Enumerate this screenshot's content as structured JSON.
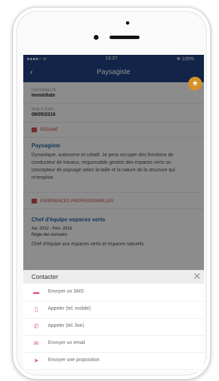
{
  "status_bar": {
    "carrier": "●●●●○ ᯤ",
    "time": "13:37",
    "battery": "✻ 100%"
  },
  "nav": {
    "back": "‹",
    "title": "Paysagiste"
  },
  "profile": {
    "availability_label": "DISPONIBILITÉ",
    "availability_value": "Immédiate",
    "updated_label": "MISE À JOUR",
    "updated_value": "08/05/2016",
    "summary_header": "RÉSUMÉ",
    "summary_title": "Paysagiste",
    "summary_text": "Dynamique, autonome et créatif. Je peux occuper des fonctions de conducteur de travaux, responsable gestion des espaces verts ou concepteur de paysage selon la taille et la nature de la structure qui m'emploie.",
    "experience_header": "EXPÉRIENCES PROFESSIONNELLES",
    "job_title": "Chef d'équipe espaces verts",
    "job_dates": "Avr. 2012 - Févr. 2016",
    "job_company": "Régie des écrivains",
    "job_text": "Chef d'équipe aux espaces verts et espaces naturels."
  },
  "contact_sheet": {
    "title": "Contacter",
    "close": "✕",
    "items": [
      {
        "label": "Envoyer un SMS",
        "icon": "sms-icon"
      },
      {
        "label": "Appeler (tel. mobile)",
        "icon": "mobile-icon"
      },
      {
        "label": "Appeler (tel. fixe)",
        "icon": "phone-icon"
      },
      {
        "label": "Envoyer un email",
        "icon": "mail-icon"
      },
      {
        "label": "Envoyer une proposition",
        "icon": "send-icon"
      }
    ]
  },
  "colors": {
    "nav": "#1f3f7a",
    "accent": "#c0392b",
    "star": "#d6902a",
    "link": "#1f5d9a"
  }
}
